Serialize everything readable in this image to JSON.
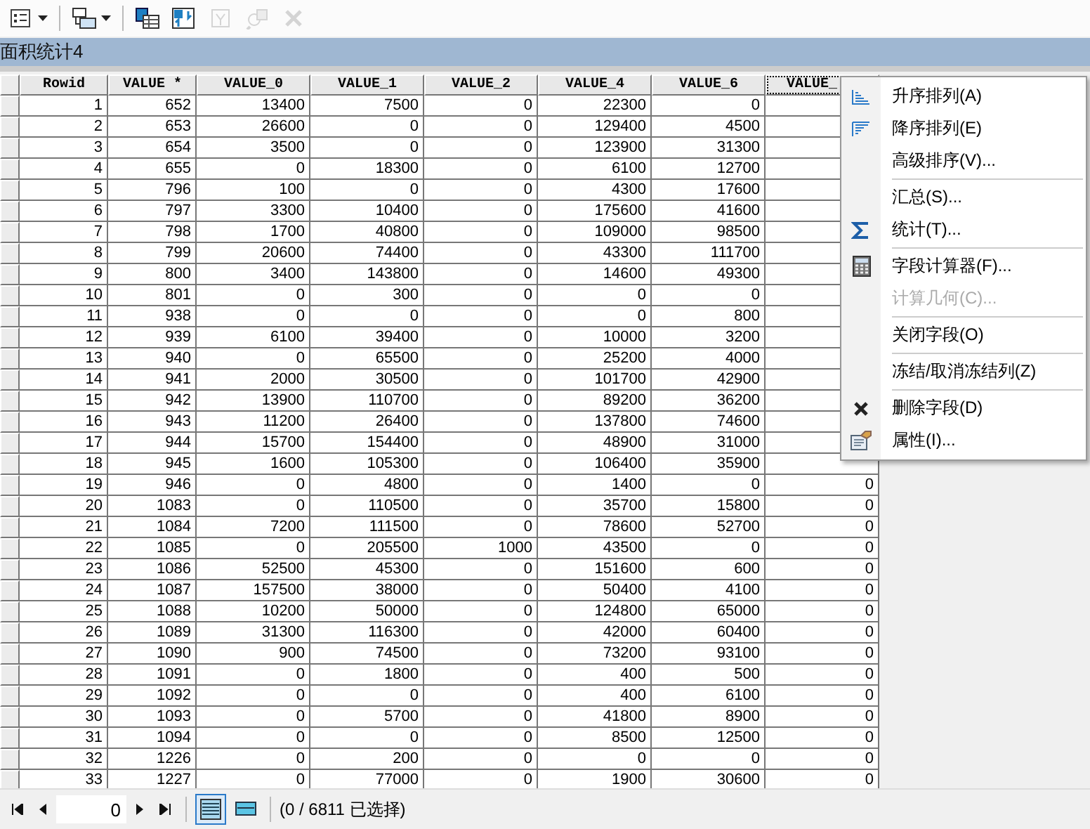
{
  "toolbar": [
    {
      "disabled": false
    },
    {
      "disabled": false
    },
    {
      "disabled": false
    },
    {
      "disabled": false
    },
    {
      "disabled": true
    },
    {
      "disabled": true
    },
    {
      "disabled": true
    }
  ],
  "window": {
    "title": "面积统计4"
  },
  "table": {
    "columns": [
      "Rowid",
      "VALUE *",
      "VALUE_0",
      "VALUE_1",
      "VALUE_2",
      "VALUE_4",
      "VALUE_6",
      "VALUE_"
    ],
    "rows": [
      [
        "1",
        "652",
        "13400",
        "7500",
        "0",
        "22300",
        "0"
      ],
      [
        "2",
        "653",
        "26600",
        "0",
        "0",
        "129400",
        "4500"
      ],
      [
        "3",
        "654",
        "3500",
        "0",
        "0",
        "123900",
        "31300"
      ],
      [
        "4",
        "655",
        "0",
        "18300",
        "0",
        "6100",
        "12700"
      ],
      [
        "5",
        "796",
        "100",
        "0",
        "0",
        "4300",
        "17600"
      ],
      [
        "6",
        "797",
        "3300",
        "10400",
        "0",
        "175600",
        "41600"
      ],
      [
        "7",
        "798",
        "1700",
        "40800",
        "0",
        "109000",
        "98500"
      ],
      [
        "8",
        "799",
        "20600",
        "74400",
        "0",
        "43300",
        "111700"
      ],
      [
        "9",
        "800",
        "3400",
        "143800",
        "0",
        "14600",
        "49300"
      ],
      [
        "10",
        "801",
        "0",
        "300",
        "0",
        "0",
        "0"
      ],
      [
        "11",
        "938",
        "0",
        "0",
        "0",
        "0",
        "800"
      ],
      [
        "12",
        "939",
        "6100",
        "39400",
        "0",
        "10000",
        "3200"
      ],
      [
        "13",
        "940",
        "0",
        "65500",
        "0",
        "25200",
        "4000"
      ],
      [
        "14",
        "941",
        "2000",
        "30500",
        "0",
        "101700",
        "42900"
      ],
      [
        "15",
        "942",
        "13900",
        "110700",
        "0",
        "89200",
        "36200"
      ],
      [
        "16",
        "943",
        "11200",
        "26400",
        "0",
        "137800",
        "74600"
      ],
      [
        "17",
        "944",
        "15700",
        "154400",
        "0",
        "48900",
        "31000"
      ],
      [
        "18",
        "945",
        "1600",
        "105300",
        "0",
        "106400",
        "35900"
      ],
      [
        "19",
        "946",
        "0",
        "4800",
        "0",
        "1400",
        "0",
        "0"
      ],
      [
        "20",
        "1083",
        "0",
        "110500",
        "0",
        "35700",
        "15800",
        "0"
      ],
      [
        "21",
        "1084",
        "7200",
        "111500",
        "0",
        "78600",
        "52700",
        "0"
      ],
      [
        "22",
        "1085",
        "0",
        "205500",
        "1000",
        "43500",
        "0",
        "0"
      ],
      [
        "23",
        "1086",
        "52500",
        "45300",
        "0",
        "151600",
        "600",
        "0"
      ],
      [
        "24",
        "1087",
        "157500",
        "38000",
        "0",
        "50400",
        "4100",
        "0"
      ],
      [
        "25",
        "1088",
        "10200",
        "50000",
        "0",
        "124800",
        "65000",
        "0"
      ],
      [
        "26",
        "1089",
        "31300",
        "116300",
        "0",
        "42000",
        "60400",
        "0"
      ],
      [
        "27",
        "1090",
        "900",
        "74500",
        "0",
        "73200",
        "93100",
        "0"
      ],
      [
        "28",
        "1091",
        "0",
        "1800",
        "0",
        "400",
        "500",
        "0"
      ],
      [
        "29",
        "1092",
        "0",
        "0",
        "0",
        "400",
        "6100",
        "0"
      ],
      [
        "30",
        "1093",
        "0",
        "5700",
        "0",
        "41800",
        "8900",
        "0"
      ],
      [
        "31",
        "1094",
        "0",
        "0",
        "0",
        "8500",
        "12500",
        "0"
      ],
      [
        "32",
        "1226",
        "0",
        "200",
        "0",
        "0",
        "0",
        "0"
      ],
      [
        "33",
        "1227",
        "0",
        "77000",
        "0",
        "1900",
        "30600",
        "0"
      ]
    ]
  },
  "context_menu": {
    "items": [
      {
        "kind": "item",
        "label": "升序排列(A)",
        "disabled": false
      },
      {
        "kind": "item",
        "label": "降序排列(E)",
        "disabled": false
      },
      {
        "kind": "item",
        "label": "高级排序(V)...",
        "disabled": false
      },
      {
        "kind": "separator"
      },
      {
        "kind": "item",
        "label": "汇总(S)...",
        "disabled": false
      },
      {
        "kind": "item",
        "label": "统计(T)...",
        "disabled": false
      },
      {
        "kind": "separator"
      },
      {
        "kind": "item",
        "label": "字段计算器(F)...",
        "disabled": false
      },
      {
        "kind": "item",
        "label": "计算几何(C)...",
        "disabled": true
      },
      {
        "kind": "separator"
      },
      {
        "kind": "item",
        "label": "关闭字段(O)",
        "disabled": false
      },
      {
        "kind": "separator"
      },
      {
        "kind": "item",
        "label": "冻结/取消冻结列(Z)",
        "disabled": false
      },
      {
        "kind": "separator"
      },
      {
        "kind": "item",
        "label": "删除字段(D)",
        "disabled": false
      },
      {
        "kind": "item",
        "label": "属性(I)...",
        "disabled": false
      }
    ]
  },
  "status_bar": {
    "record": "0",
    "views": [
      {
        "selected": true
      },
      {
        "selected": false
      }
    ],
    "selection": "(0 / 6811 已选择)"
  }
}
